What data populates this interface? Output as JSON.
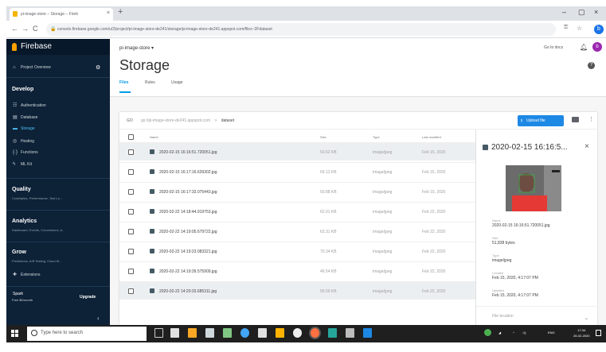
{
  "browser": {
    "tab_title": "pi-image-store – Storage – Fireb",
    "tab_close": "×",
    "new_tab": "+",
    "minimize": "–",
    "maximize": "▢",
    "close": "×",
    "back": "←",
    "forward": "→",
    "reload": "C",
    "url": "console.firebase.google.com/u/2/project/pi-image-store-de241/storage/pi-image-store-de241.appspot.com/files~2Fdataset",
    "profile_initial": "b"
  },
  "sidebar": {
    "app_name": "Firebase",
    "project_overview": "Project Overview",
    "develop_label": "Develop",
    "develop_items": [
      "Authentication",
      "Database",
      "Storage",
      "Hosting",
      "Functions",
      "ML Kit"
    ],
    "sections": [
      {
        "title": "Quality",
        "subtitle": "Crashlytics, Performance, Test La..."
      },
      {
        "title": "Analytics",
        "subtitle": "Dashboard, Events, Conversions, A..."
      },
      {
        "title": "Grow",
        "subtitle": "Predictions, A/B Testing, Cloud M..."
      }
    ],
    "extensions": "Extensions",
    "plan_name": "Spark",
    "plan_price": "Free $0/month",
    "upgrade": "Upgrade",
    "collapse": "‹"
  },
  "header": {
    "project_select": "pi-image-store ▾",
    "go_to_docs": "Go to docs",
    "avatar_initial": "b",
    "title": "Storage",
    "help": "?"
  },
  "tabs": [
    "Files",
    "Rules",
    "Usage"
  ],
  "toolbar": {
    "link_icon": "GO",
    "bucket": "gs://pi-image-store-de241.appspot.com",
    "separator": ">",
    "folder": "dataset",
    "upload": "Upload file",
    "more": "⋮"
  },
  "table": {
    "columns": [
      "Name",
      "Size",
      "Type",
      "Last modified"
    ],
    "rows": [
      {
        "name": "2020-02-15 16:16:51.720051.jpg",
        "size": "50.62 KB",
        "type": "image/jpeg",
        "modified": "Feb 15, 2020",
        "selected": true
      },
      {
        "name": "2020-02-15 16:17:16.639302.jpg",
        "size": "69.13 KB",
        "type": "image/jpeg",
        "modified": "Feb 15, 2020",
        "selected": false
      },
      {
        "name": "2020-02-15 16:17:33.075443.jpg",
        "size": "50.88 KB",
        "type": "image/jpeg",
        "modified": "Feb 15, 2020",
        "selected": false
      },
      {
        "name": "2020-02-22 14:18:44.919753.jpg",
        "size": "62.91 KB",
        "type": "image/jpeg",
        "modified": "Feb 22, 2020",
        "selected": false
      },
      {
        "name": "2020-02-22 14:19:05.679722.jpg",
        "size": "63.31 KB",
        "type": "image/jpeg",
        "modified": "Feb 22, 2020",
        "selected": false
      },
      {
        "name": "2020-02-22 14:19:23.083321.jpg",
        "size": "70.34 KB",
        "type": "image/jpeg",
        "modified": "Feb 22, 2020",
        "selected": false
      },
      {
        "name": "2020-02-22 14:19:39.575909.jpg",
        "size": "46.54 KB",
        "type": "image/jpeg",
        "modified": "Feb 22, 2020",
        "selected": false
      },
      {
        "name": "2020-02-22 14:20:33.685311.jpg",
        "size": "59.59 KB",
        "type": "image/jpeg",
        "modified": "Feb 22, 2020",
        "selected": true
      }
    ]
  },
  "details": {
    "title": "2020-02-15 16:16:5...",
    "close": "×",
    "fields": [
      {
        "label": "Name",
        "value": "2020-02-15 16:16:51.720051.jpg"
      },
      {
        "label": "Size",
        "value": "51,838 bytes"
      },
      {
        "label": "Type",
        "value": "image/jpeg"
      },
      {
        "label": "Created",
        "value": "Feb 15, 2020, 4:17:07 PM"
      },
      {
        "label": "Updated",
        "value": "Feb 15, 2020, 4:17:07 PM"
      }
    ],
    "file_location": "File location",
    "expand": "⌄"
  },
  "taskbar": {
    "search_placeholder": "Type here to search",
    "tray_lang": "ENG",
    "time": "17:34",
    "date": "26-02-2020"
  },
  "colors": {
    "sidebar_bg": "#0d2137",
    "accent": "#039be5",
    "upload_button": "#1e88e5",
    "taskbar": "#1f1f1f"
  }
}
